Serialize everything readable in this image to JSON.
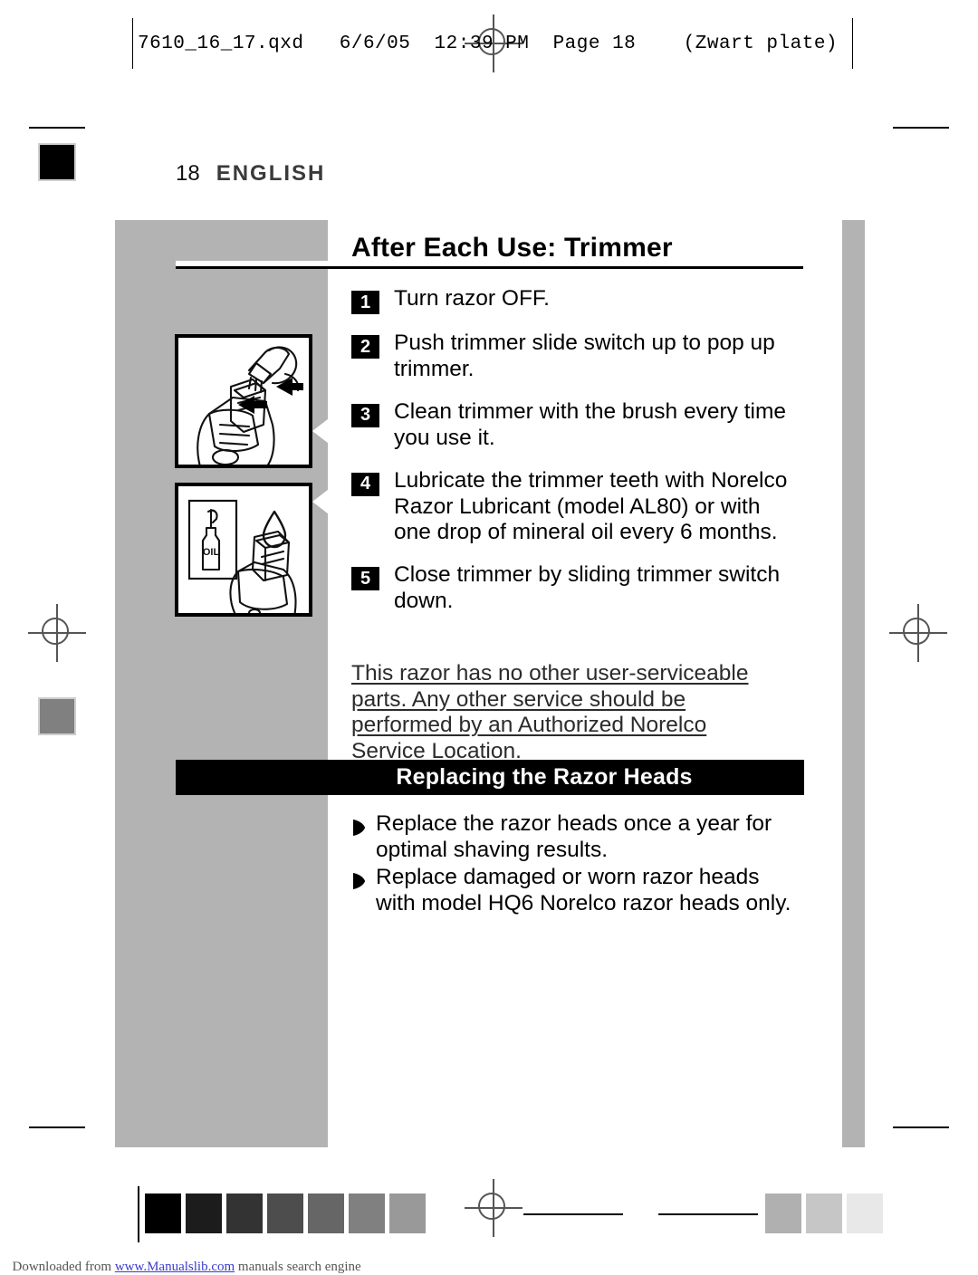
{
  "print_header": {
    "text": "7610_16_17.qxd   6/6/05  12:39 PM  Page 18    (Zwart plate)"
  },
  "page": {
    "number": "18",
    "language": "ENGLISH"
  },
  "section": {
    "title": "After Each Use: Trimmer",
    "steps": [
      {
        "num": "1",
        "text": "Turn razor OFF."
      },
      {
        "num": "2",
        "text": "Push trimmer slide switch up to pop up trimmer."
      },
      {
        "num": "3",
        "text": "Clean trimmer with the brush every time you use it."
      },
      {
        "num": "4",
        "text": "Lubricate the trimmer teeth with Norelco Razor Lubricant (model AL80) or with one drop of mineral oil every 6 months."
      },
      {
        "num": "5",
        "text": "Close trimmer by sliding trimmer switch down."
      }
    ],
    "note": "This razor has no other user-serviceable parts. Any other service should be performed by an Authorized Norelco Service Location."
  },
  "banner": {
    "title": "Replacing the Razor Heads"
  },
  "bullets": [
    {
      "text": "Replace the razor heads once a year for optimal shaving results."
    },
    {
      "text": "Replace damaged or worn razor heads with model HQ6 Norelco razor heads only."
    }
  ],
  "illustrations": [
    {
      "caption": "trimmer-brush-cleaning"
    },
    {
      "caption": "trimmer-oil-lubrication",
      "label": "OIL"
    }
  ],
  "calibration": {
    "swatches": [
      "#000000",
      "#1c1c1c",
      "#333333",
      "#4d4d4d",
      "#666666",
      "#808080",
      "#999999",
      "#b0b0b0",
      "#c6c6c6",
      "#e8e8e8"
    ]
  },
  "footer": {
    "prefix": "Downloaded from ",
    "link": "www.Manualslib.com",
    "suffix": " manuals search engine"
  },
  "colors": {
    "gray_column": "#b3b3b3",
    "banner_bg": "#000000",
    "link": "#3b3bcf"
  }
}
